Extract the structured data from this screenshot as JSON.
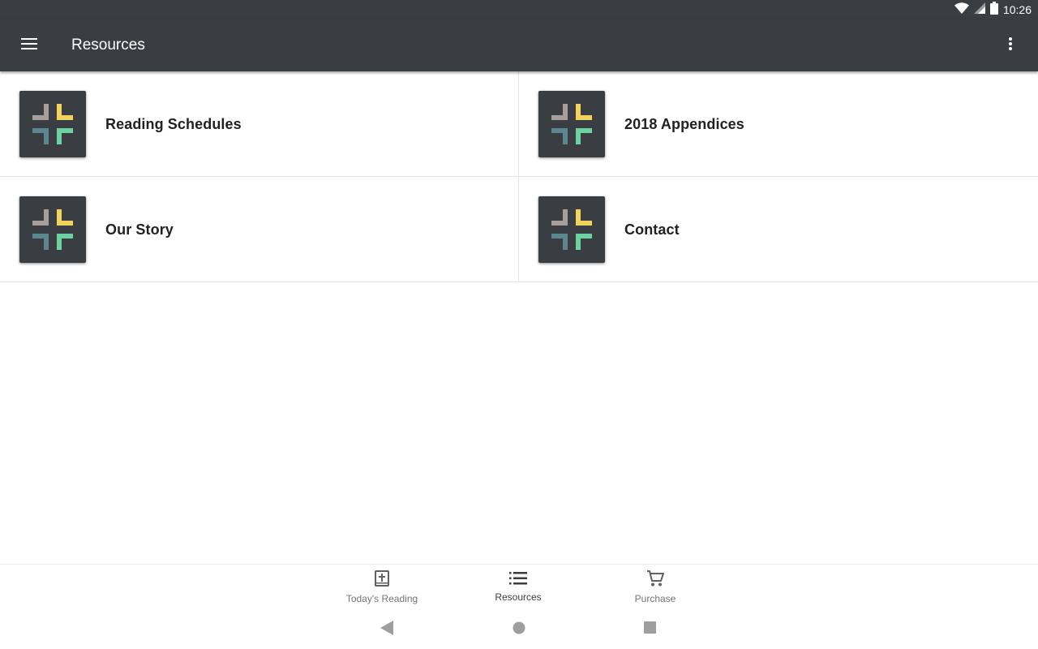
{
  "status_bar": {
    "time": "10:26",
    "icons": [
      "wifi-icon",
      "cell-signal-icon",
      "battery-icon"
    ]
  },
  "app_bar": {
    "title": "Resources",
    "menu_icon": "hamburger-menu-icon",
    "overflow_icon": "more-vert-icon"
  },
  "resources": [
    {
      "label": "Reading Schedules",
      "icon": "logo-cross-icon"
    },
    {
      "label": "2018 Appendices",
      "icon": "logo-cross-icon"
    },
    {
      "label": "Our Story",
      "icon": "logo-cross-icon"
    },
    {
      "label": "Contact",
      "icon": "logo-cross-icon"
    }
  ],
  "bottom_nav": {
    "items": [
      {
        "label": "Today's Reading",
        "icon": "bible-icon",
        "active": false
      },
      {
        "label": "Resources",
        "icon": "list-icon",
        "active": true
      },
      {
        "label": "Purchase",
        "icon": "cart-icon",
        "active": false
      }
    ]
  },
  "colors": {
    "app_bar": "#3a3d41",
    "logo_gray": "#a79f98",
    "logo_yellow": "#f0d35c",
    "logo_teal": "#5b8791",
    "logo_green": "#6fd19f",
    "text_primary": "#212121",
    "nav_inactive": "#757575"
  }
}
